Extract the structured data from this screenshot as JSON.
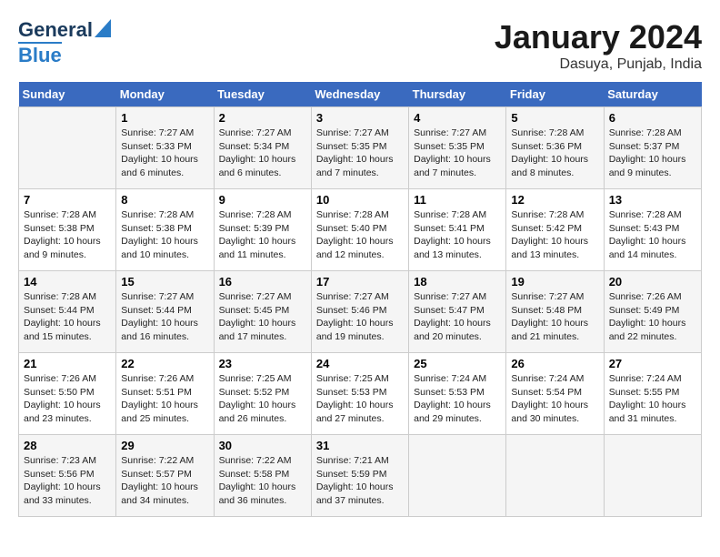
{
  "header": {
    "logo_line1": "General",
    "logo_line2": "Blue",
    "title": "January 2024",
    "subtitle": "Dasuya, Punjab, India"
  },
  "columns": [
    "Sunday",
    "Monday",
    "Tuesday",
    "Wednesday",
    "Thursday",
    "Friday",
    "Saturday"
  ],
  "weeks": [
    [
      {
        "day": "",
        "info": ""
      },
      {
        "day": "1",
        "info": "Sunrise: 7:27 AM\nSunset: 5:33 PM\nDaylight: 10 hours\nand 6 minutes."
      },
      {
        "day": "2",
        "info": "Sunrise: 7:27 AM\nSunset: 5:34 PM\nDaylight: 10 hours\nand 6 minutes."
      },
      {
        "day": "3",
        "info": "Sunrise: 7:27 AM\nSunset: 5:35 PM\nDaylight: 10 hours\nand 7 minutes."
      },
      {
        "day": "4",
        "info": "Sunrise: 7:27 AM\nSunset: 5:35 PM\nDaylight: 10 hours\nand 7 minutes."
      },
      {
        "day": "5",
        "info": "Sunrise: 7:28 AM\nSunset: 5:36 PM\nDaylight: 10 hours\nand 8 minutes."
      },
      {
        "day": "6",
        "info": "Sunrise: 7:28 AM\nSunset: 5:37 PM\nDaylight: 10 hours\nand 9 minutes."
      }
    ],
    [
      {
        "day": "7",
        "info": "Sunrise: 7:28 AM\nSunset: 5:38 PM\nDaylight: 10 hours\nand 9 minutes."
      },
      {
        "day": "8",
        "info": "Sunrise: 7:28 AM\nSunset: 5:38 PM\nDaylight: 10 hours\nand 10 minutes."
      },
      {
        "day": "9",
        "info": "Sunrise: 7:28 AM\nSunset: 5:39 PM\nDaylight: 10 hours\nand 11 minutes."
      },
      {
        "day": "10",
        "info": "Sunrise: 7:28 AM\nSunset: 5:40 PM\nDaylight: 10 hours\nand 12 minutes."
      },
      {
        "day": "11",
        "info": "Sunrise: 7:28 AM\nSunset: 5:41 PM\nDaylight: 10 hours\nand 13 minutes."
      },
      {
        "day": "12",
        "info": "Sunrise: 7:28 AM\nSunset: 5:42 PM\nDaylight: 10 hours\nand 13 minutes."
      },
      {
        "day": "13",
        "info": "Sunrise: 7:28 AM\nSunset: 5:43 PM\nDaylight: 10 hours\nand 14 minutes."
      }
    ],
    [
      {
        "day": "14",
        "info": "Sunrise: 7:28 AM\nSunset: 5:44 PM\nDaylight: 10 hours\nand 15 minutes."
      },
      {
        "day": "15",
        "info": "Sunrise: 7:27 AM\nSunset: 5:44 PM\nDaylight: 10 hours\nand 16 minutes."
      },
      {
        "day": "16",
        "info": "Sunrise: 7:27 AM\nSunset: 5:45 PM\nDaylight: 10 hours\nand 17 minutes."
      },
      {
        "day": "17",
        "info": "Sunrise: 7:27 AM\nSunset: 5:46 PM\nDaylight: 10 hours\nand 19 minutes."
      },
      {
        "day": "18",
        "info": "Sunrise: 7:27 AM\nSunset: 5:47 PM\nDaylight: 10 hours\nand 20 minutes."
      },
      {
        "day": "19",
        "info": "Sunrise: 7:27 AM\nSunset: 5:48 PM\nDaylight: 10 hours\nand 21 minutes."
      },
      {
        "day": "20",
        "info": "Sunrise: 7:26 AM\nSunset: 5:49 PM\nDaylight: 10 hours\nand 22 minutes."
      }
    ],
    [
      {
        "day": "21",
        "info": "Sunrise: 7:26 AM\nSunset: 5:50 PM\nDaylight: 10 hours\nand 23 minutes."
      },
      {
        "day": "22",
        "info": "Sunrise: 7:26 AM\nSunset: 5:51 PM\nDaylight: 10 hours\nand 25 minutes."
      },
      {
        "day": "23",
        "info": "Sunrise: 7:25 AM\nSunset: 5:52 PM\nDaylight: 10 hours\nand 26 minutes."
      },
      {
        "day": "24",
        "info": "Sunrise: 7:25 AM\nSunset: 5:53 PM\nDaylight: 10 hours\nand 27 minutes."
      },
      {
        "day": "25",
        "info": "Sunrise: 7:24 AM\nSunset: 5:53 PM\nDaylight: 10 hours\nand 29 minutes."
      },
      {
        "day": "26",
        "info": "Sunrise: 7:24 AM\nSunset: 5:54 PM\nDaylight: 10 hours\nand 30 minutes."
      },
      {
        "day": "27",
        "info": "Sunrise: 7:24 AM\nSunset: 5:55 PM\nDaylight: 10 hours\nand 31 minutes."
      }
    ],
    [
      {
        "day": "28",
        "info": "Sunrise: 7:23 AM\nSunset: 5:56 PM\nDaylight: 10 hours\nand 33 minutes."
      },
      {
        "day": "29",
        "info": "Sunrise: 7:22 AM\nSunset: 5:57 PM\nDaylight: 10 hours\nand 34 minutes."
      },
      {
        "day": "30",
        "info": "Sunrise: 7:22 AM\nSunset: 5:58 PM\nDaylight: 10 hours\nand 36 minutes."
      },
      {
        "day": "31",
        "info": "Sunrise: 7:21 AM\nSunset: 5:59 PM\nDaylight: 10 hours\nand 37 minutes."
      },
      {
        "day": "",
        "info": ""
      },
      {
        "day": "",
        "info": ""
      },
      {
        "day": "",
        "info": ""
      }
    ]
  ]
}
